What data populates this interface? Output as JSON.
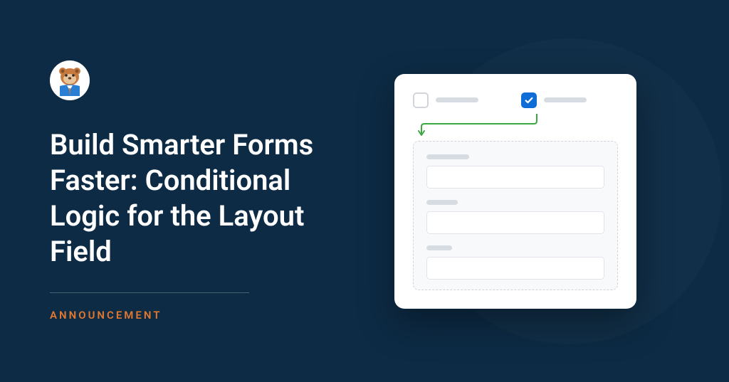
{
  "title": "Build Smarter Forms Faster: Conditional Logic for the Layout Field",
  "category": "ANNOUNCEMENT",
  "colors": {
    "background": "#0d2b45",
    "accent": "#e27730",
    "checkbox_active": "#0e6dd6",
    "arrow": "#3aa83f"
  }
}
